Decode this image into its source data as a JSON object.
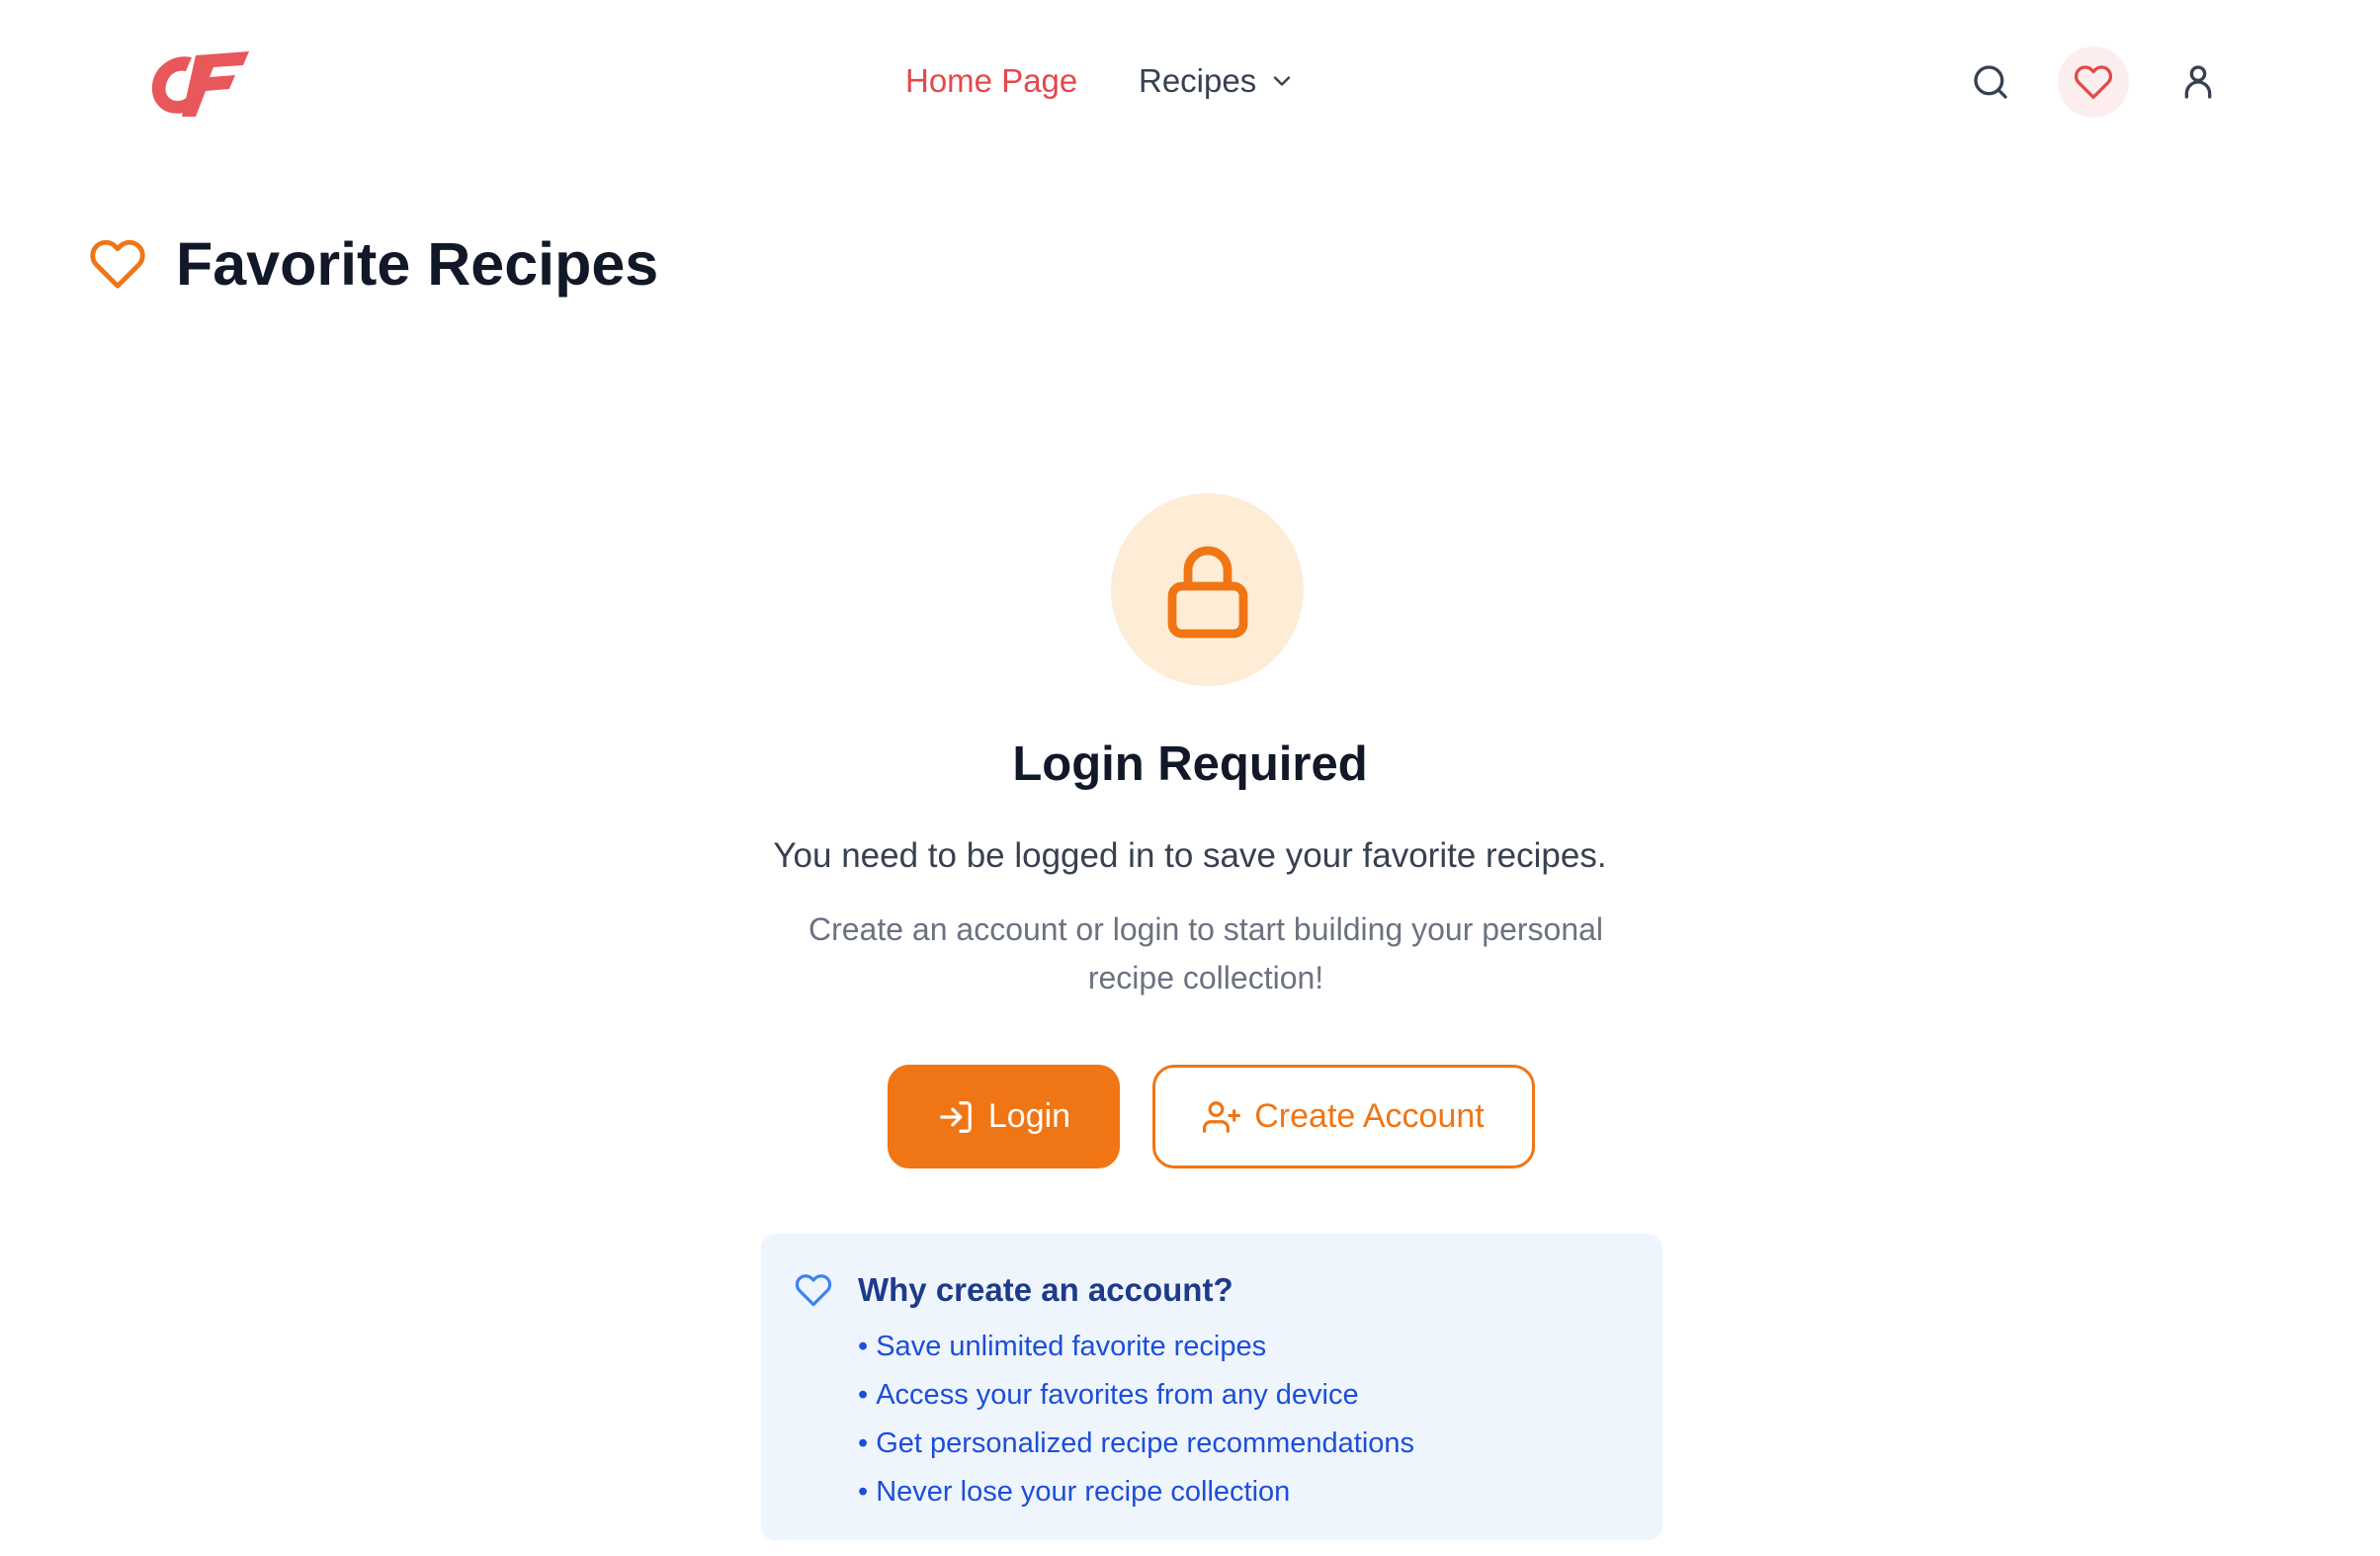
{
  "nav": {
    "home": "Home Page",
    "recipes": "Recipes"
  },
  "page": {
    "title": "Favorite Recipes"
  },
  "login_card": {
    "title": "Login Required",
    "lead": "You need to be logged in to save your favorite recipes.",
    "sub": "Create an account or login to start building your personal recipe collection!",
    "login_button": "Login",
    "create_button": "Create Account"
  },
  "info": {
    "title": "Why create an account?",
    "items": [
      "Save unlimited favorite recipes",
      "Access your favorites from any device",
      "Get personalized recipe recommendations",
      "Never lose your recipe collection"
    ]
  },
  "colors": {
    "brand_orange": "#f07515",
    "nav_active_red": "#e5484d",
    "logo_red": "#e8585a",
    "info_blue": "#1d4ed8",
    "info_bg": "#eff5fd"
  },
  "icons": {
    "logo": "cf-logo",
    "search": "search-icon",
    "favorites": "heart-icon",
    "account": "user-icon",
    "title": "heart-outline-icon",
    "lock": "lock-icon",
    "login": "log-in-icon",
    "create": "user-plus-icon",
    "info": "heart-outline-icon"
  }
}
